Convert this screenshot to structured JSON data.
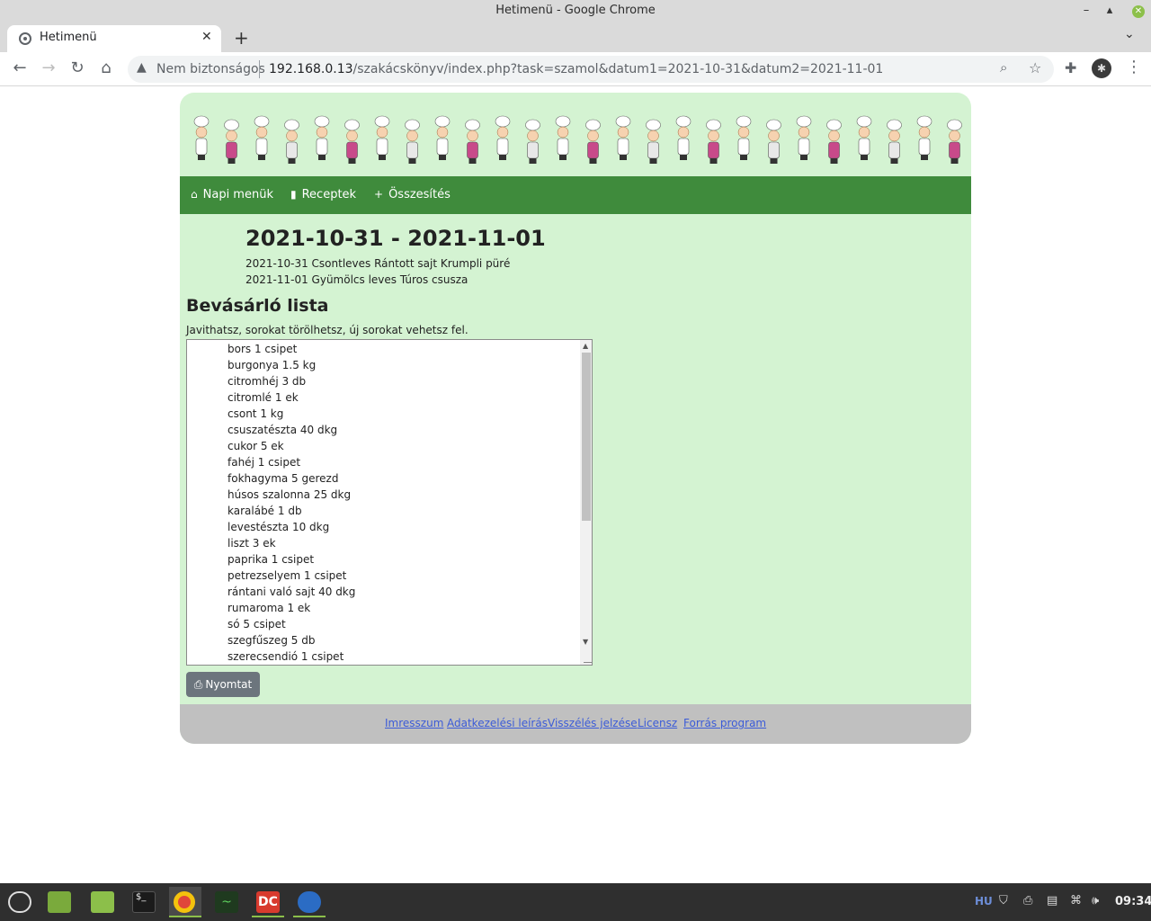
{
  "window": {
    "title": "Hetimenü - Google Chrome"
  },
  "browser": {
    "tab_title": "Hetimenü",
    "security_label": "Nem biztonságos",
    "url_host": "192.168.0.13",
    "url_path": "/szakácskönyv/index.php?task=szamol&datum1=2021-10-31&datum2=2021-11-01"
  },
  "nav": {
    "items": [
      {
        "label": "Napi menük",
        "icon": "home-icon"
      },
      {
        "label": "Receptek",
        "icon": "book-icon"
      },
      {
        "label": "Összesítés",
        "icon": "plus-icon"
      }
    ]
  },
  "main": {
    "title": "2021-10-31 - 2021-11-01",
    "menus": [
      "2021-10-31 Csontleves Rántott sajt Krumpli püré",
      "2021-11-01 Gyümölcs leves Túros csusza"
    ],
    "shopping_heading": "Bevásárló lista",
    "shopping_hint": "Javithatsz, sorokat törölhetsz, új sorokat vehetsz fel.",
    "shopping_items": [
      "bors 1 csipet",
      "burgonya 1.5 kg",
      "citromhéj 3 db",
      "citromlé 1 ek",
      "csont 1 kg",
      "csuszatészta 40 dkg",
      "cukor 5 ek",
      "fahéj 1 csipet",
      "fokhagyma 5 gerezd",
      "húsos szalonna 25 dkg",
      "karalábé 1 db",
      "levestészta 10 dkg",
      "liszt 3 ek",
      "paprika 1 csipet",
      "petrezselyem 1 csipet",
      "rántani való sajt 40 dkg",
      "rumaroma 1 ek",
      "só 5 csipet",
      "szegfűszeg 5 db",
      "szerecsendió 1 csipet"
    ],
    "print_label": "Nyomtat"
  },
  "footer": {
    "links": [
      "Imresszum",
      "Adatkezelési leírás",
      "Visszélés jelzése",
      "Licensz",
      "Forrás program"
    ]
  },
  "taskbar": {
    "language": "HU",
    "time": "09:34"
  },
  "colors": {
    "page_bg": "#d4f3d2",
    "nav_bg": "#3f8b3c",
    "footer_bg": "#c0c0c0",
    "button_bg": "#6c757d",
    "link": "#3b5bd8"
  }
}
